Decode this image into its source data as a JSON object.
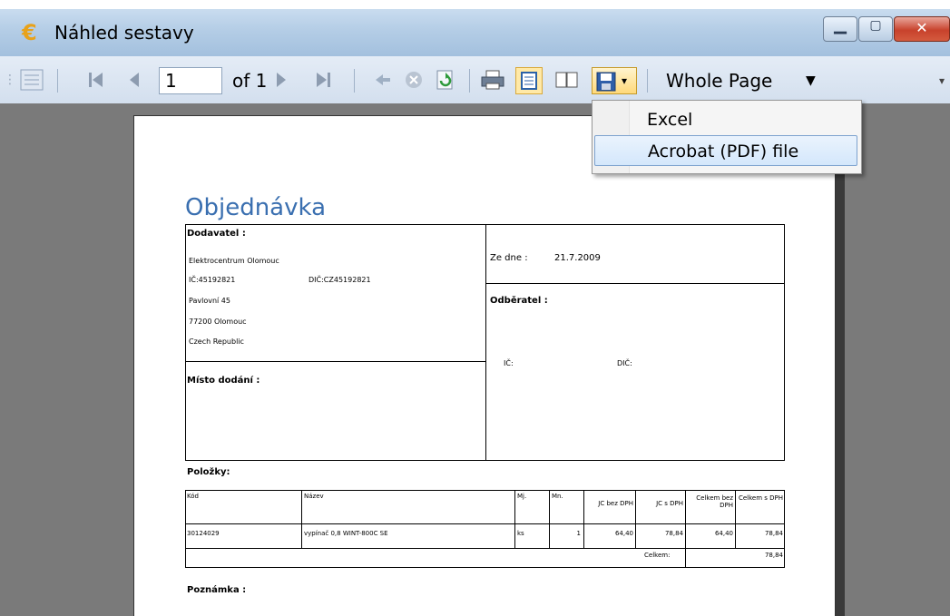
{
  "window": {
    "title": "Náhled sestavy",
    "icon": "euro-icon",
    "controls": [
      "minimize-icon",
      "maximize-icon",
      "close-icon"
    ]
  },
  "toolbar": {
    "page_current": "1",
    "page_of_label": "of 1",
    "zoom_value": "Whole Page",
    "icons": [
      "group-tree-icon",
      "first-page-icon",
      "previous-page-icon",
      "next-page-icon",
      "last-page-icon",
      "back-icon",
      "stop-icon",
      "refresh-icon",
      "print-icon",
      "page-setup-icon",
      "multi-page-icon",
      "export-save-icon"
    ]
  },
  "export_menu": {
    "items": [
      "Excel",
      "Acrobat (PDF) file"
    ],
    "highlighted": "Acrobat (PDF) file"
  },
  "document": {
    "title": "Objednávka",
    "supplier_label": "Dodavatel :",
    "supplier_name": "Elektrocentrum Olomouc",
    "supplier_ic": "IČ:45192821",
    "supplier_dic": "DIČ:CZ45192821",
    "supplier_street": "Pavlovní 45",
    "supplier_city": "77200 Olomouc",
    "supplier_country": "Czech Republic",
    "date_label": "Ze dne :",
    "date_value": "21.7.2009",
    "customer_label": "Odběratel :",
    "customer_ic": "IČ:",
    "customer_dic": "DIČ:",
    "delivery_label": "Místo dodání :",
    "items_label": "Položky:",
    "table_headers": [
      "Kód",
      "Název",
      "Mj.",
      "Mn.",
      "JC bez DPH",
      "JC s DPH",
      "Celkem bez DPH",
      "Celkem s DPH"
    ],
    "table_rows": [
      [
        "30124029",
        "vypínač 0,8 WINT-800C SE",
        "ks",
        "1",
        "64,40",
        "78,84",
        "64,40",
        "78,84"
      ]
    ],
    "total_label": "Celkem:",
    "total_value": "78,84",
    "note_label": "Poznámka :"
  }
}
